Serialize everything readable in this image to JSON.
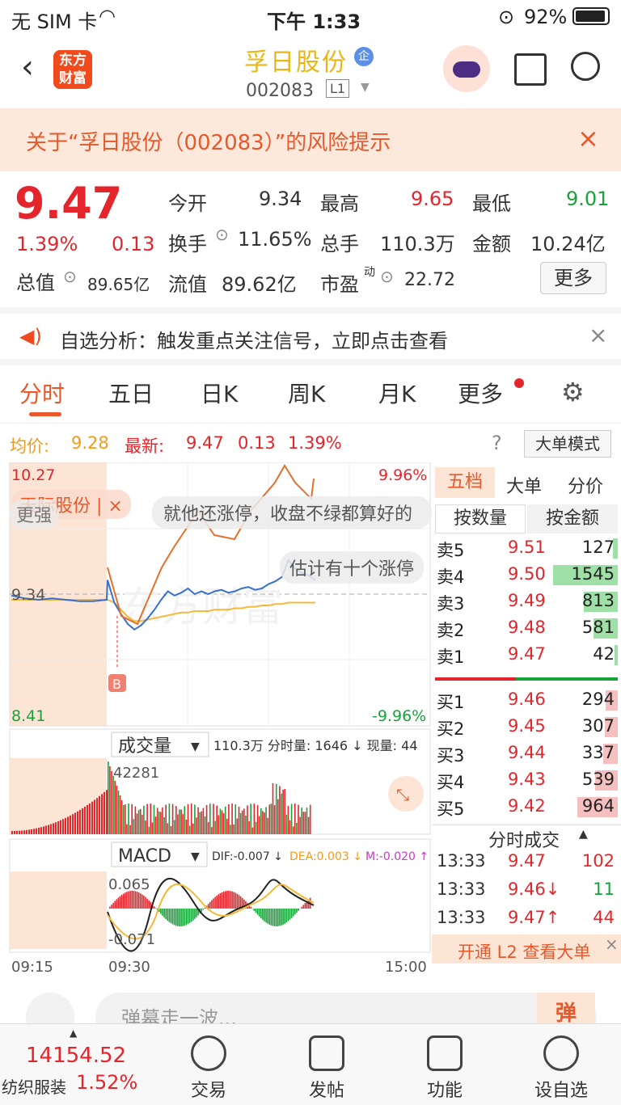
{
  "status_bar": {
    "carrier": "无 SIM 卡",
    "time": "下午 1:33",
    "battery": "92%"
  },
  "header": {
    "logo": "东方财富",
    "title": "孚日股份",
    "title_badge": "企",
    "code": "002083",
    "level": "L1"
  },
  "banner": {
    "text": "关于“孚日股份（002083）”的风险提示"
  },
  "quote": {
    "price": "9.47",
    "change_pct": "1.39%",
    "change": "0.13",
    "open_label": "今开",
    "open": "9.34",
    "high_label": "最高",
    "high": "9.65",
    "low_label": "最低",
    "low": "9.01",
    "turnover_label": "换手",
    "turnover": "11.65%",
    "volume_label": "总手",
    "volume": "110.3万",
    "amount_label": "金额",
    "amount": "10.24亿",
    "mcap_label": "总值",
    "mcap": "89.65亿",
    "float_label": "流值",
    "float": "89.62亿",
    "pe_label": "市盈",
    "pe_sup": "动",
    "pe": "22.72",
    "more_button": "更多"
  },
  "ad": {
    "text": "自选分析：触发重点关注信号，立即点击查看"
  },
  "tabs": [
    "分时",
    "五日",
    "日K",
    "周K",
    "月K",
    "更多"
  ],
  "chart_info": {
    "avg_label": "均价:",
    "avg": "9.28",
    "last_label": "最新:",
    "last": "9.47",
    "chg": "0.13",
    "pct": "1.39%",
    "mode_button": "大单模式"
  },
  "chart_labels": {
    "y_max": "10.27",
    "y_mid": "9.34",
    "y_min": "8.41",
    "pct_max": "9.96%",
    "pct_min": "-9.96%",
    "b_marker": "B",
    "watermark": "东方财富",
    "x_labels": [
      "09:15",
      "09:30",
      "15:00"
    ]
  },
  "danmaku": [
    "天际股份",
    "更强",
    "就他还涨停，收盘不绿都算好的",
    "估计有十个涨停"
  ],
  "volume_panel": {
    "selector": "成交量",
    "summary": "110.3万 分时量: 1646 ↓ 现量: 44",
    "peak": "42281"
  },
  "macd_panel": {
    "selector": "MACD",
    "dif": "DIF:-0.007 ↓",
    "dea": "DEA:0.003 ↓",
    "m": "M:-0.020 ↑",
    "top": "0.065",
    "bottom": "-0.071"
  },
  "book": {
    "tabs": [
      "五档",
      "大单",
      "分价"
    ],
    "subtabs": [
      "按数量",
      "按金额"
    ],
    "asks": [
      {
        "label": "卖5",
        "price": "9.51",
        "vol": "127",
        "frac": 0.08
      },
      {
        "label": "卖4",
        "price": "9.50",
        "vol": "1545",
        "frac": 1
      },
      {
        "label": "卖3",
        "price": "9.49",
        "vol": "813",
        "frac": 0.53
      },
      {
        "label": "卖2",
        "price": "9.48",
        "vol": "581",
        "frac": 0.38
      },
      {
        "label": "卖1",
        "price": "9.47",
        "vol": "42",
        "frac": 0.03
      }
    ],
    "bids": [
      {
        "label": "买1",
        "price": "9.46",
        "vol": "294",
        "frac": 0.19
      },
      {
        "label": "买2",
        "price": "9.45",
        "vol": "307",
        "frac": 0.2
      },
      {
        "label": "买3",
        "price": "9.44",
        "vol": "337",
        "frac": 0.22
      },
      {
        "label": "买4",
        "price": "9.43",
        "vol": "539",
        "frac": 0.35
      },
      {
        "label": "买5",
        "price": "9.42",
        "vol": "964",
        "frac": 0.62
      }
    ],
    "ticks_title": "分时成交",
    "ticks": [
      {
        "time": "13:33",
        "price": "9.47",
        "vol": "102"
      },
      {
        "time": "13:33",
        "price": "9.46↓",
        "vol": "11"
      },
      {
        "time": "13:33",
        "price": "9.47↑",
        "vol": "44"
      }
    ],
    "l2_promo": "开通 L2 查看大单"
  },
  "comment": {
    "placeholder": "弹幕走一波...",
    "danmaku_button": "弹"
  },
  "bottom": {
    "index_value": "14154.52",
    "index_name": "纺织服装",
    "index_pct": "1.52%",
    "items": [
      "交易",
      "发帖",
      "功能",
      "设自选"
    ]
  },
  "chart_data": {
    "type": "line",
    "title": "",
    "ylim": [
      8.41,
      10.27
    ],
    "prev_close": 9.34,
    "x_range": [
      "09:15",
      "15:00"
    ],
    "series": [
      {
        "name": "最新",
        "values": [
          9.33,
          9.31,
          9.3,
          9.31,
          9.3,
          9.29,
          9.29,
          9.3,
          9.44,
          9.28,
          9.2,
          9.13,
          9.09,
          9.12,
          9.17,
          9.23,
          9.3,
          9.36,
          9.33,
          9.35,
          9.38,
          9.34,
          9.36,
          9.34,
          9.36,
          9.37,
          9.35,
          9.36,
          9.38,
          9.39,
          9.37,
          9.38,
          9.41,
          9.43,
          9.46,
          9.58,
          9.52,
          9.49,
          9.47,
          9.44
        ]
      },
      {
        "name": "均价",
        "values": [
          9.3,
          9.3,
          9.3,
          9.3,
          9.3,
          9.3,
          9.3,
          9.3,
          9.3,
          9.28,
          9.23,
          9.18,
          9.15,
          9.15,
          9.16,
          9.17,
          9.18,
          9.19,
          9.2,
          9.21,
          9.21,
          9.22,
          9.22,
          9.22,
          9.23,
          9.23,
          9.23,
          9.24,
          9.24,
          9.25,
          9.25,
          9.26,
          9.26,
          9.27,
          9.27,
          9.28,
          9.28,
          9.28,
          9.28,
          9.28
        ]
      }
    ]
  }
}
